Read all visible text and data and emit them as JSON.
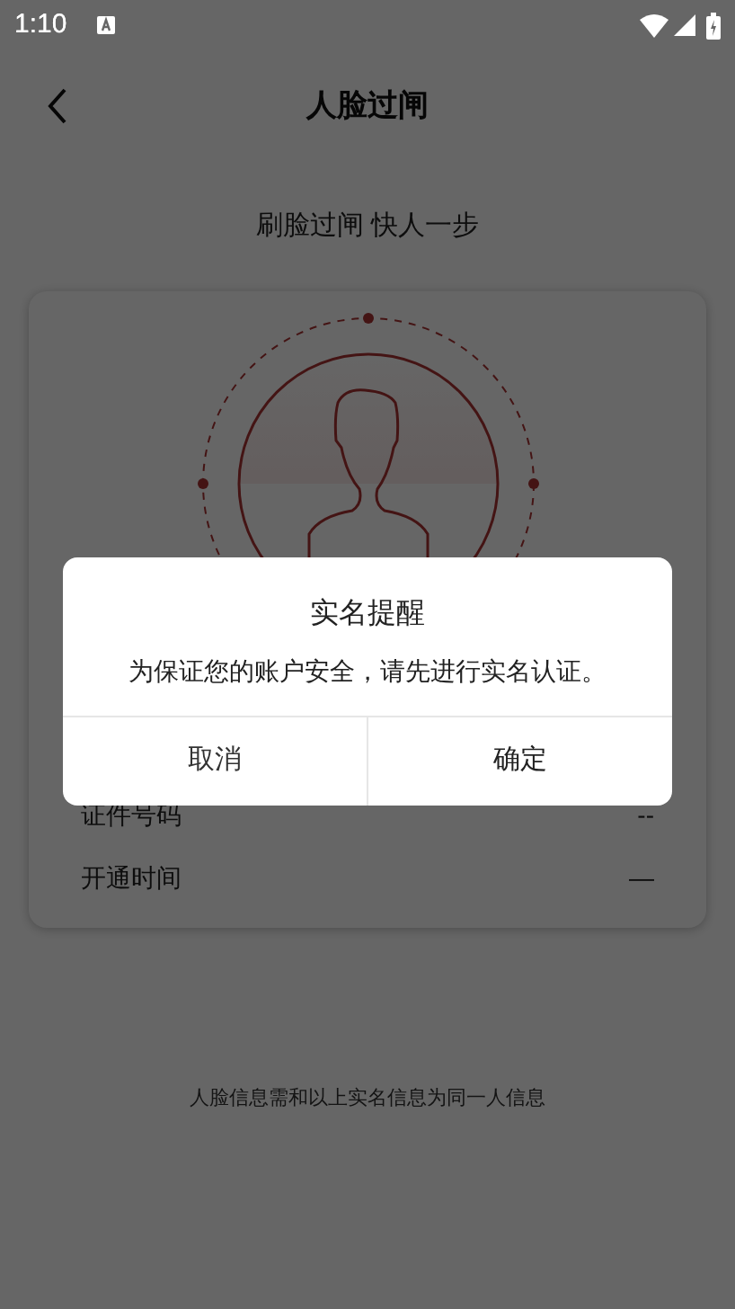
{
  "status_bar": {
    "time": "1:10"
  },
  "header": {
    "title": "人脸过闸"
  },
  "subtitle": "刷脸过闸 快人一步",
  "info_rows": [
    {
      "label": "证件号码",
      "value": "--"
    },
    {
      "label": "开通时间",
      "value": "—"
    }
  ],
  "footer_note": "人脸信息需和以上实名信息为同一人信息",
  "dialog": {
    "title": "实名提醒",
    "message": "为保证您的账户安全，请先进行实名认证。",
    "buttons": [
      {
        "label": "取消",
        "kind": "cancel"
      },
      {
        "label": "确定",
        "kind": "confirm"
      }
    ]
  }
}
